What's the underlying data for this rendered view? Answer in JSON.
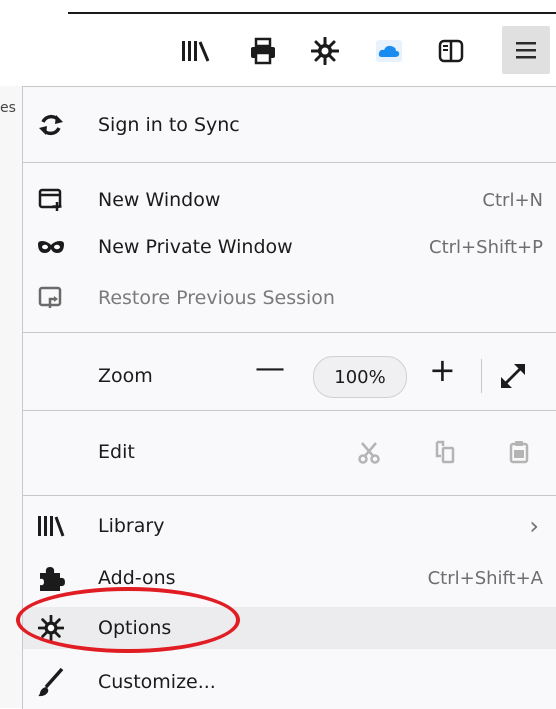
{
  "page": {
    "partial_text": "es"
  },
  "toolbar": {
    "icons": [
      "library-icon",
      "print-icon",
      "gear-icon",
      "cloud-icon",
      "sidebar-icon",
      "hamburger-menu-icon"
    ]
  },
  "menu": {
    "sync_label": "Sign in to Sync",
    "new_window_label": "New Window",
    "new_window_shortcut": "Ctrl+N",
    "private_window_label": "New Private Window",
    "private_window_shortcut": "Ctrl+Shift+P",
    "restore_label": "Restore Previous Session",
    "zoom_label": "Zoom",
    "zoom_minus": "—",
    "zoom_value": "100%",
    "zoom_plus": "+",
    "edit_label": "Edit",
    "library_label": "Library",
    "library_arrow": "›",
    "addons_label": "Add-ons",
    "addons_shortcut": "Ctrl+Shift+A",
    "options_label": "Options",
    "customize_label": "Customize..."
  },
  "colors": {
    "highlight_circle": "#e11d24",
    "panel_bg": "#f9f9fb"
  }
}
